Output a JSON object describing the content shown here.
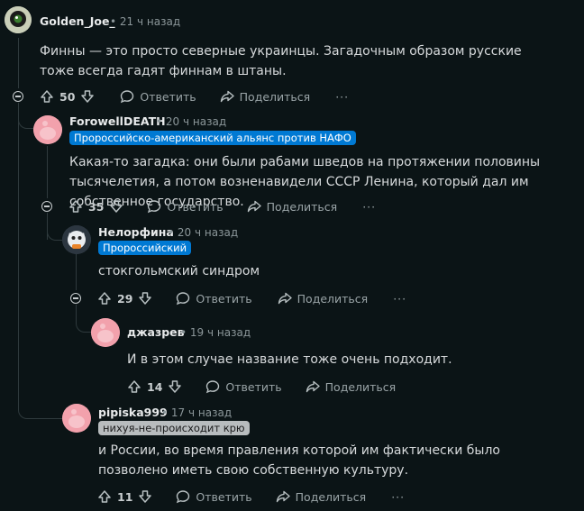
{
  "comments": [
    {
      "user": "Golden_Joe_",
      "time": "21 ч назад",
      "text": "Финны — это просто северные украинцы. Загадочным образом русские тоже всегда гадят финнам в штаны.",
      "votes": "50"
    },
    {
      "user": "ForowellDEATH",
      "time": "20 ч назад",
      "flair": "Пророссийско-американский альянс против НАФО",
      "text": "Какая-то загадка: они были рабами шведов на протяжении половины тысячелетия, а потом возненавидели СССР Ленина, который дал им собственное государство.",
      "votes": "35"
    },
    {
      "user": "Нелорфина",
      "time": "20 ч назад",
      "flair": "Пророссийский",
      "text": "стокгольмский синдром",
      "votes": "29"
    },
    {
      "user": "джазрев",
      "time": "19 ч назад",
      "text": "И в этом случае название тоже очень подходит.",
      "votes": "14"
    },
    {
      "user": "pipiska999",
      "time": "17 ч назад",
      "flair": "нихуя-не-происходит крю",
      "text": "и России, во время правления которой им фактически было позволено иметь свою собственную культуру.",
      "votes": "11"
    }
  ],
  "labels": {
    "reply": "Ответить",
    "share": "Поделиться",
    "separator": "•",
    "more": "···"
  },
  "colors": {
    "background": "#0b1416",
    "flair_blue": "#0079d3",
    "flair_gray": "#b8bcbe",
    "avatar_pink": "#f2a1ac"
  }
}
